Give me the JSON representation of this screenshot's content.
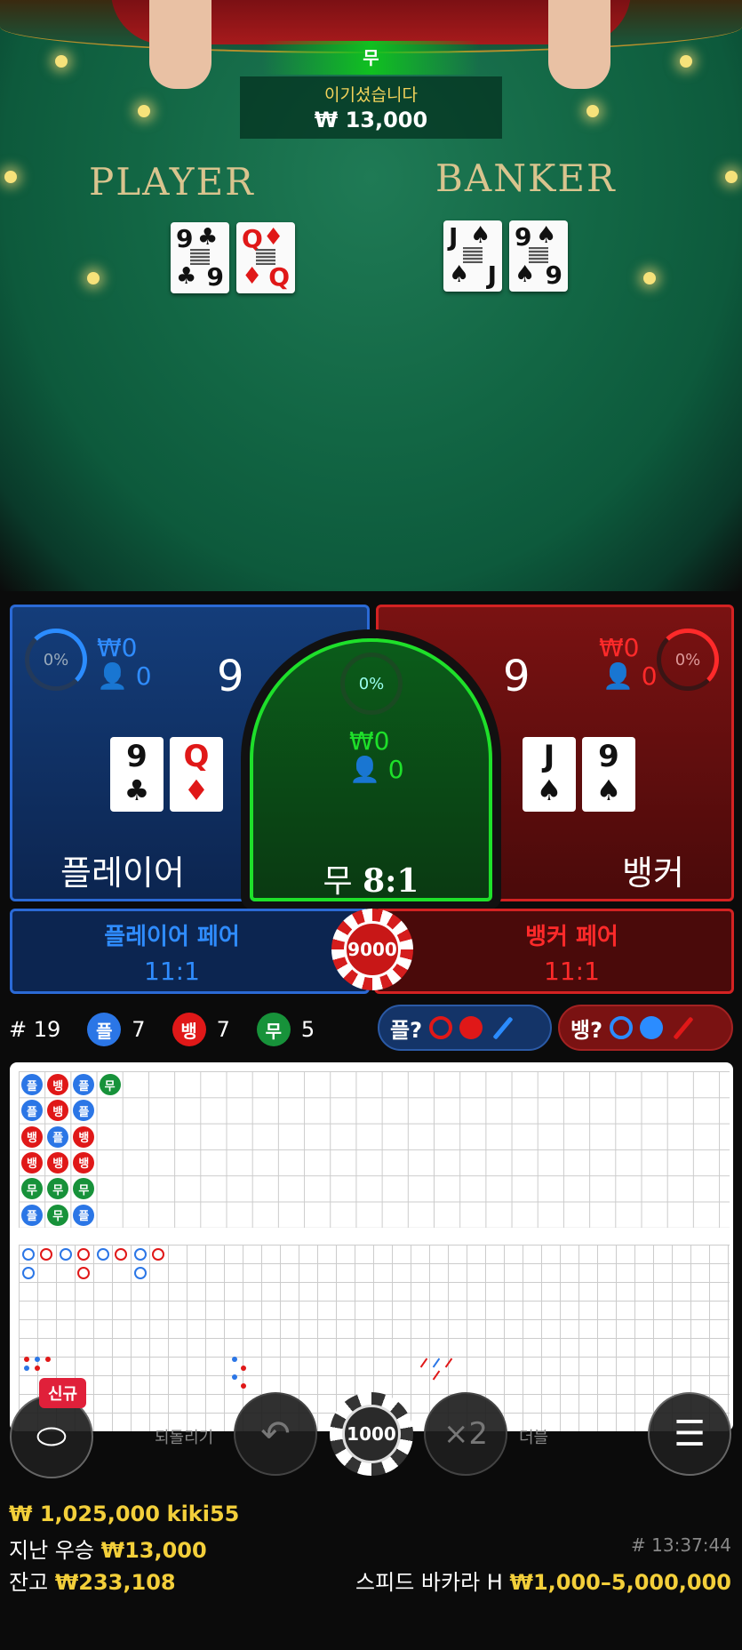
{
  "video": {
    "banner": "무",
    "win_text": "이기셨습니다",
    "win_amount": "₩ 13,000",
    "player_label": "PLAYER",
    "banker_label": "BANKER",
    "player_cards": [
      {
        "rank": "9",
        "suit": "♣"
      },
      {
        "rank": "Q",
        "suit": "♦"
      }
    ],
    "banker_cards": [
      {
        "rank": "J",
        "suit": "♠"
      },
      {
        "rank": "9",
        "suit": "♠"
      }
    ]
  },
  "player_panel": {
    "percent": "0%",
    "bet": "₩0",
    "count": "0",
    "score": "9",
    "label": "플레이어",
    "cards": [
      {
        "rank": "9",
        "suit": "♣"
      },
      {
        "rank": "Q",
        "suit": "♦"
      }
    ]
  },
  "tie_panel": {
    "percent": "0%",
    "bet": "₩0",
    "count": "0",
    "label": "무",
    "odds": "8:1"
  },
  "banker_panel": {
    "percent": "0%",
    "bet": "₩0",
    "count": "0",
    "score": "9",
    "label": "뱅커",
    "cards": [
      {
        "rank": "J",
        "suit": "♠"
      },
      {
        "rank": "9",
        "suit": "♠"
      }
    ]
  },
  "pairs": {
    "player_name": "플레이어 페어",
    "player_odds": "11:1",
    "banker_name": "뱅커 페어",
    "banker_odds": "11:1",
    "chip": "9000"
  },
  "stats": {
    "round": "# 19",
    "player_sym": "플",
    "player_count": "7",
    "banker_sym": "뱅",
    "banker_count": "7",
    "tie_sym": "무",
    "tie_count": "5",
    "predict_player": "플?",
    "predict_banker": "뱅?"
  },
  "bead_road": [
    [
      "플",
      "플",
      "뱅",
      "뱅",
      "무",
      "플"
    ],
    [
      "뱅",
      "뱅",
      "플",
      "뱅",
      "무",
      "무"
    ],
    [
      "플",
      "플",
      "뱅",
      "뱅",
      "무",
      "플"
    ],
    [
      "무"
    ]
  ],
  "controls": {
    "new_badge": "신규",
    "left_label": "되돌리기",
    "right_label": "더블",
    "chip": "1000",
    "double": "×2"
  },
  "colors": {
    "player": "#2b76e6",
    "banker": "#e01818",
    "tie": "#17923a",
    "gold": "#f3cf3a"
  },
  "footer": {
    "total": "₩ 1,025,000",
    "user": "kiki55",
    "last_win_label": "지난 우승",
    "last_win": "₩13,000",
    "balance_label": "잔고",
    "balance": "₩233,108",
    "time": "# 13:37:44",
    "table_name": "스피드 바카라 H",
    "limits": "₩1,000–5,000,000"
  }
}
